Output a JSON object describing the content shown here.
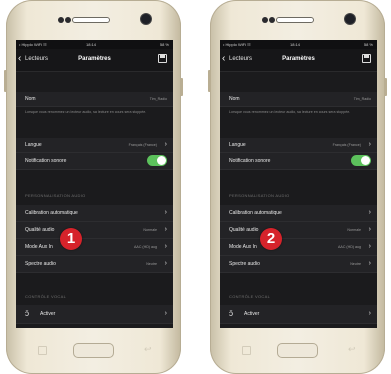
{
  "phones": [
    {
      "status": {
        "carrier": "• Hipplo WiFi ☷",
        "time": "18:14",
        "battery": "58 %"
      },
      "nav": {
        "back_label": "Lecteurs",
        "title": "Paramètres"
      },
      "rows": {
        "name": {
          "label": "Nom",
          "value": "Tim_Radio"
        },
        "hint": "Lorsque vous renommez un lecteur audio, sa lecture en cours sera stoppée.",
        "language": {
          "label": "Langue",
          "value": "Français (France)"
        },
        "notifications": {
          "label": "Notification sonore",
          "enabled": true
        },
        "section_audio": "PERSONNALISATION AUDIO",
        "calibration": {
          "label": "Calibration automatique"
        },
        "quality": {
          "label": "Qualité audio",
          "value": "Normale"
        },
        "mode": {
          "label": "Mode Aux In",
          "value": "AAC (HD) aug"
        },
        "spectrum": {
          "label": "Spectre audio",
          "value": "Neutre"
        },
        "section_voice": "CONTRÔLE VOCAL",
        "voice": {
          "label": "Activer"
        }
      },
      "badge": "1"
    },
    {
      "status": {
        "carrier": "• Hipplo WiFi ☷",
        "time": "18:14",
        "battery": "58 %"
      },
      "nav": {
        "back_label": "Lecteurs",
        "title": "Paramètres"
      },
      "rows": {
        "name": {
          "label": "Nom",
          "value": "Tim_Radio"
        },
        "hint": "Lorsque vous renommez un lecteur audio, sa lecture en cours sera stoppée.",
        "language": {
          "label": "Langue",
          "value": "Français (France)"
        },
        "notifications": {
          "label": "Notification sonore",
          "enabled": true
        },
        "section_audio": "PERSONNALISATION AUDIO",
        "calibration": {
          "label": "Calibration automatique"
        },
        "quality": {
          "label": "Qualité audio",
          "value": "Normale"
        },
        "mode": {
          "label": "Mode Aux In",
          "value": "AAC (HD) aug"
        },
        "spectrum": {
          "label": "Spectre audio",
          "value": "Neutre"
        },
        "section_voice": "CONTRÔLE VOCAL",
        "voice": {
          "label": "Activer"
        }
      },
      "badge": "2"
    }
  ],
  "colors": {
    "toggle_on": "#5cc15c",
    "badge": "#d6232b",
    "screen_bg": "#1b1b1d"
  }
}
